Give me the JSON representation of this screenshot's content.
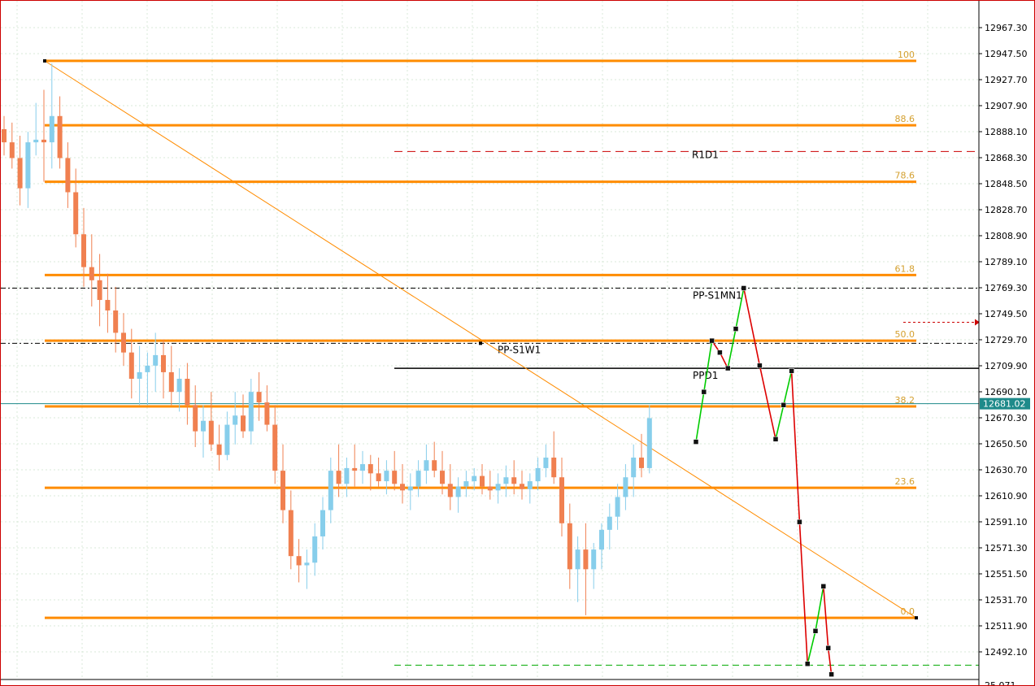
{
  "chart_data": {
    "type": "candlestick",
    "y_axis": {
      "ticks": [
        "12967.30",
        "12947.50",
        "12927.70",
        "12907.90",
        "12888.10",
        "12868.30",
        "12848.50",
        "12828.70",
        "12808.90",
        "12789.10",
        "12769.30",
        "12749.50",
        "12729.70",
        "12709.90",
        "12690.10",
        "12670.30",
        "12650.50",
        "12630.70",
        "12610.90",
        "12591.10",
        "12571.30",
        "12551.50",
        "12531.70",
        "12511.90",
        "12492.10"
      ],
      "range": [
        12478,
        12985
      ],
      "last_price": "12681.02",
      "last_price_value": 12681.02,
      "bottom_partial_label": "25.071"
    },
    "colors": {
      "bull": "#87ceeb",
      "bear": "#f08050",
      "fib": "#ff8c00",
      "fib_label": "#d4a030",
      "grid": "#d8e8d8",
      "price_line": "#1e8a8a",
      "path_up": "#00cc00",
      "path_down": "#dd0000",
      "resistance": "#cc0000",
      "support": "#00aa00"
    },
    "fib_levels": [
      {
        "label": "100",
        "price": 12942
      },
      {
        "label": "88.6",
        "price": 12893
      },
      {
        "label": "78.6",
        "price": 12850
      },
      {
        "label": "61.8",
        "price": 12779
      },
      {
        "label": "50.0",
        "price": 12729
      },
      {
        "label": "38.2",
        "price": 12679
      },
      {
        "label": "23.6",
        "price": 12617
      },
      {
        "label": "0.0",
        "price": 12518
      }
    ],
    "pivot_lines": [
      {
        "label": "R1D1",
        "price": 12873,
        "style": "dash-red"
      },
      {
        "label": "PP-S1MN1",
        "price": 12769,
        "style": "dashdot-black"
      },
      {
        "label": "PP-S1W1",
        "price": 12727,
        "style": "dashdot-black"
      },
      {
        "label": "PPD1",
        "price": 12708,
        "style": "solid-black"
      },
      {
        "label": "",
        "price": 12482,
        "style": "dash-green"
      }
    ],
    "trendline": {
      "from": {
        "bar": 0,
        "price": 12942
      },
      "to": {
        "bar": 113,
        "price": 12518
      }
    },
    "candles": [
      [
        12890,
        12900,
        12870,
        12880
      ],
      [
        12880,
        12895,
        12860,
        12868
      ],
      [
        12868,
        12885,
        12832,
        12845
      ],
      [
        12845,
        12888,
        12830,
        12880
      ],
      [
        12880,
        12910,
        12870,
        12882
      ],
      [
        12882,
        12920,
        12850,
        12880
      ],
      [
        12880,
        12940,
        12860,
        12900
      ],
      [
        12900,
        12915,
        12860,
        12868
      ],
      [
        12868,
        12880,
        12830,
        12842
      ],
      [
        12842,
        12860,
        12800,
        12810
      ],
      [
        12810,
        12830,
        12770,
        12785
      ],
      [
        12785,
        12810,
        12755,
        12775
      ],
      [
        12775,
        12795,
        12740,
        12760
      ],
      [
        12760,
        12780,
        12735,
        12752
      ],
      [
        12752,
        12770,
        12720,
        12735
      ],
      [
        12735,
        12750,
        12710,
        12720
      ],
      [
        12720,
        12738,
        12685,
        12700
      ],
      [
        12700,
        12725,
        12680,
        12705
      ],
      [
        12705,
        12720,
        12680,
        12710
      ],
      [
        12710,
        12735,
        12690,
        12718
      ],
      [
        12718,
        12730,
        12685,
        12705
      ],
      [
        12705,
        12725,
        12680,
        12690
      ],
      [
        12690,
        12708,
        12675,
        12700
      ],
      [
        12700,
        12712,
        12665,
        12680
      ],
      [
        12680,
        12695,
        12648,
        12660
      ],
      [
        12660,
        12680,
        12640,
        12668
      ],
      [
        12668,
        12690,
        12645,
        12650
      ],
      [
        12650,
        12665,
        12630,
        12642
      ],
      [
        12642,
        12675,
        12638,
        12665
      ],
      [
        12665,
        12690,
        12650,
        12672
      ],
      [
        12672,
        12688,
        12655,
        12660
      ],
      [
        12660,
        12700,
        12650,
        12690
      ],
      [
        12690,
        12705,
        12668,
        12682
      ],
      [
        12682,
        12695,
        12660,
        12665
      ],
      [
        12665,
        12680,
        12620,
        12630
      ],
      [
        12630,
        12650,
        12590,
        12600
      ],
      [
        12600,
        12615,
        12555,
        12565
      ],
      [
        12565,
        12578,
        12545,
        12558
      ],
      [
        12558,
        12570,
        12540,
        12560
      ],
      [
        12560,
        12590,
        12550,
        12580
      ],
      [
        12580,
        12610,
        12570,
        12600
      ],
      [
        12600,
        12640,
        12590,
        12630
      ],
      [
        12630,
        12650,
        12610,
        12620
      ],
      [
        12620,
        12640,
        12610,
        12632
      ],
      [
        12632,
        12650,
        12618,
        12630
      ],
      [
        12630,
        12645,
        12620,
        12635
      ],
      [
        12635,
        12642,
        12615,
        12628
      ],
      [
        12628,
        12640,
        12618,
        12622
      ],
      [
        12622,
        12638,
        12612,
        12630
      ],
      [
        12630,
        12645,
        12615,
        12620
      ],
      [
        12620,
        12635,
        12605,
        12615
      ],
      [
        12615,
        12628,
        12600,
        12618
      ],
      [
        12618,
        12638,
        12610,
        12630
      ],
      [
        12630,
        12650,
        12620,
        12638
      ],
      [
        12638,
        12652,
        12625,
        12630
      ],
      [
        12630,
        12645,
        12612,
        12620
      ],
      [
        12620,
        12635,
        12600,
        12610
      ],
      [
        12610,
        12625,
        12598,
        12618
      ],
      [
        12618,
        12630,
        12610,
        12622
      ],
      [
        12622,
        12632,
        12615,
        12626
      ],
      [
        12626,
        12635,
        12612,
        12618
      ],
      [
        12618,
        12630,
        12608,
        12615
      ],
      [
        12615,
        12628,
        12605,
        12620
      ],
      [
        12620,
        12634,
        12610,
        12625
      ],
      [
        12625,
        12638,
        12612,
        12620
      ],
      [
        12620,
        12630,
        12608,
        12616
      ],
      [
        12616,
        12628,
        12605,
        12622
      ],
      [
        12622,
        12640,
        12615,
        12632
      ],
      [
        12632,
        12650,
        12625,
        12640
      ],
      [
        12640,
        12660,
        12620,
        12625
      ],
      [
        12625,
        12640,
        12580,
        12590
      ],
      [
        12590,
        12605,
        12540,
        12555
      ],
      [
        12555,
        12580,
        12530,
        12570
      ],
      [
        12570,
        12590,
        12520,
        12555
      ],
      [
        12555,
        12575,
        12540,
        12570
      ],
      [
        12570,
        12590,
        12555,
        12585
      ],
      [
        12585,
        12605,
        12570,
        12595
      ],
      [
        12595,
        12620,
        12585,
        12610
      ],
      [
        12610,
        12635,
        12600,
        12625
      ],
      [
        12625,
        12650,
        12610,
        12640
      ],
      [
        12640,
        12658,
        12625,
        12632
      ],
      [
        12632,
        12680,
        12628,
        12670
      ]
    ],
    "path_markers": [
      {
        "bar": 85,
        "price": 12652
      },
      {
        "bar": 86,
        "price": 12690
      },
      {
        "bar": 87,
        "price": 12729
      },
      {
        "bar": 88,
        "price": 12720
      },
      {
        "bar": 89,
        "price": 12708
      },
      {
        "bar": 90,
        "price": 12738
      },
      {
        "bar": 91,
        "price": 12769
      },
      {
        "bar": 93,
        "price": 12710
      },
      {
        "bar": 95,
        "price": 12654
      },
      {
        "bar": 96,
        "price": 12680
      },
      {
        "bar": 97,
        "price": 12706
      },
      {
        "bar": 98,
        "price": 12591
      },
      {
        "bar": 99,
        "price": 12483
      },
      {
        "bar": 100,
        "price": 12508
      },
      {
        "bar": 101,
        "price": 12542
      },
      {
        "bar": 101.6,
        "price": 12495
      },
      {
        "bar": 102,
        "price": 12475
      }
    ]
  }
}
